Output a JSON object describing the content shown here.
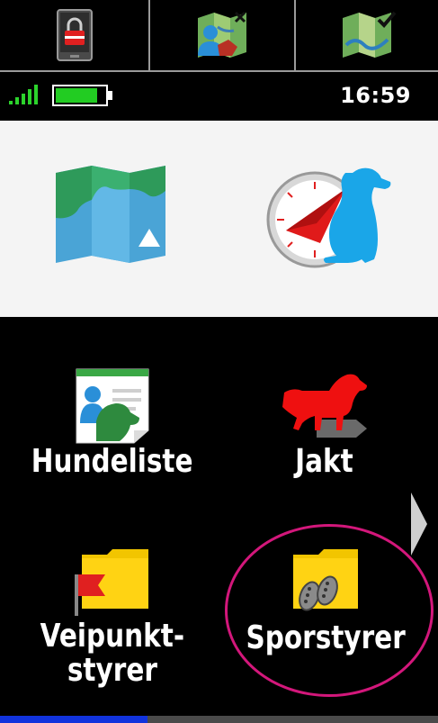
{
  "status": {
    "time": "16:59",
    "signal_bars": 5,
    "battery_level": 0.85
  },
  "toolbar": {
    "buttons": [
      {
        "icon": "lock-screen-icon"
      },
      {
        "icon": "map-contact-remove-icon"
      },
      {
        "icon": "map-track-check-icon"
      }
    ]
  },
  "favorites": [
    {
      "icon": "map-app-icon"
    },
    {
      "icon": "dog-compass-icon"
    }
  ],
  "apps": [
    {
      "label": "Hundeliste",
      "icon": "dog-list-icon"
    },
    {
      "label": "Jakt",
      "icon": "hunting-dog-icon"
    },
    {
      "label": "Veipunkt-\nstyrer",
      "icon": "waypoint-manager-icon"
    },
    {
      "label": "Sporstyrer",
      "icon": "track-manager-icon"
    }
  ],
  "pagination": {
    "current_page": 1,
    "total_pages": 3
  },
  "colors": {
    "highlight": "#d3177b",
    "page_indicator_active": "#1133dd",
    "battery": "#22cc22"
  }
}
